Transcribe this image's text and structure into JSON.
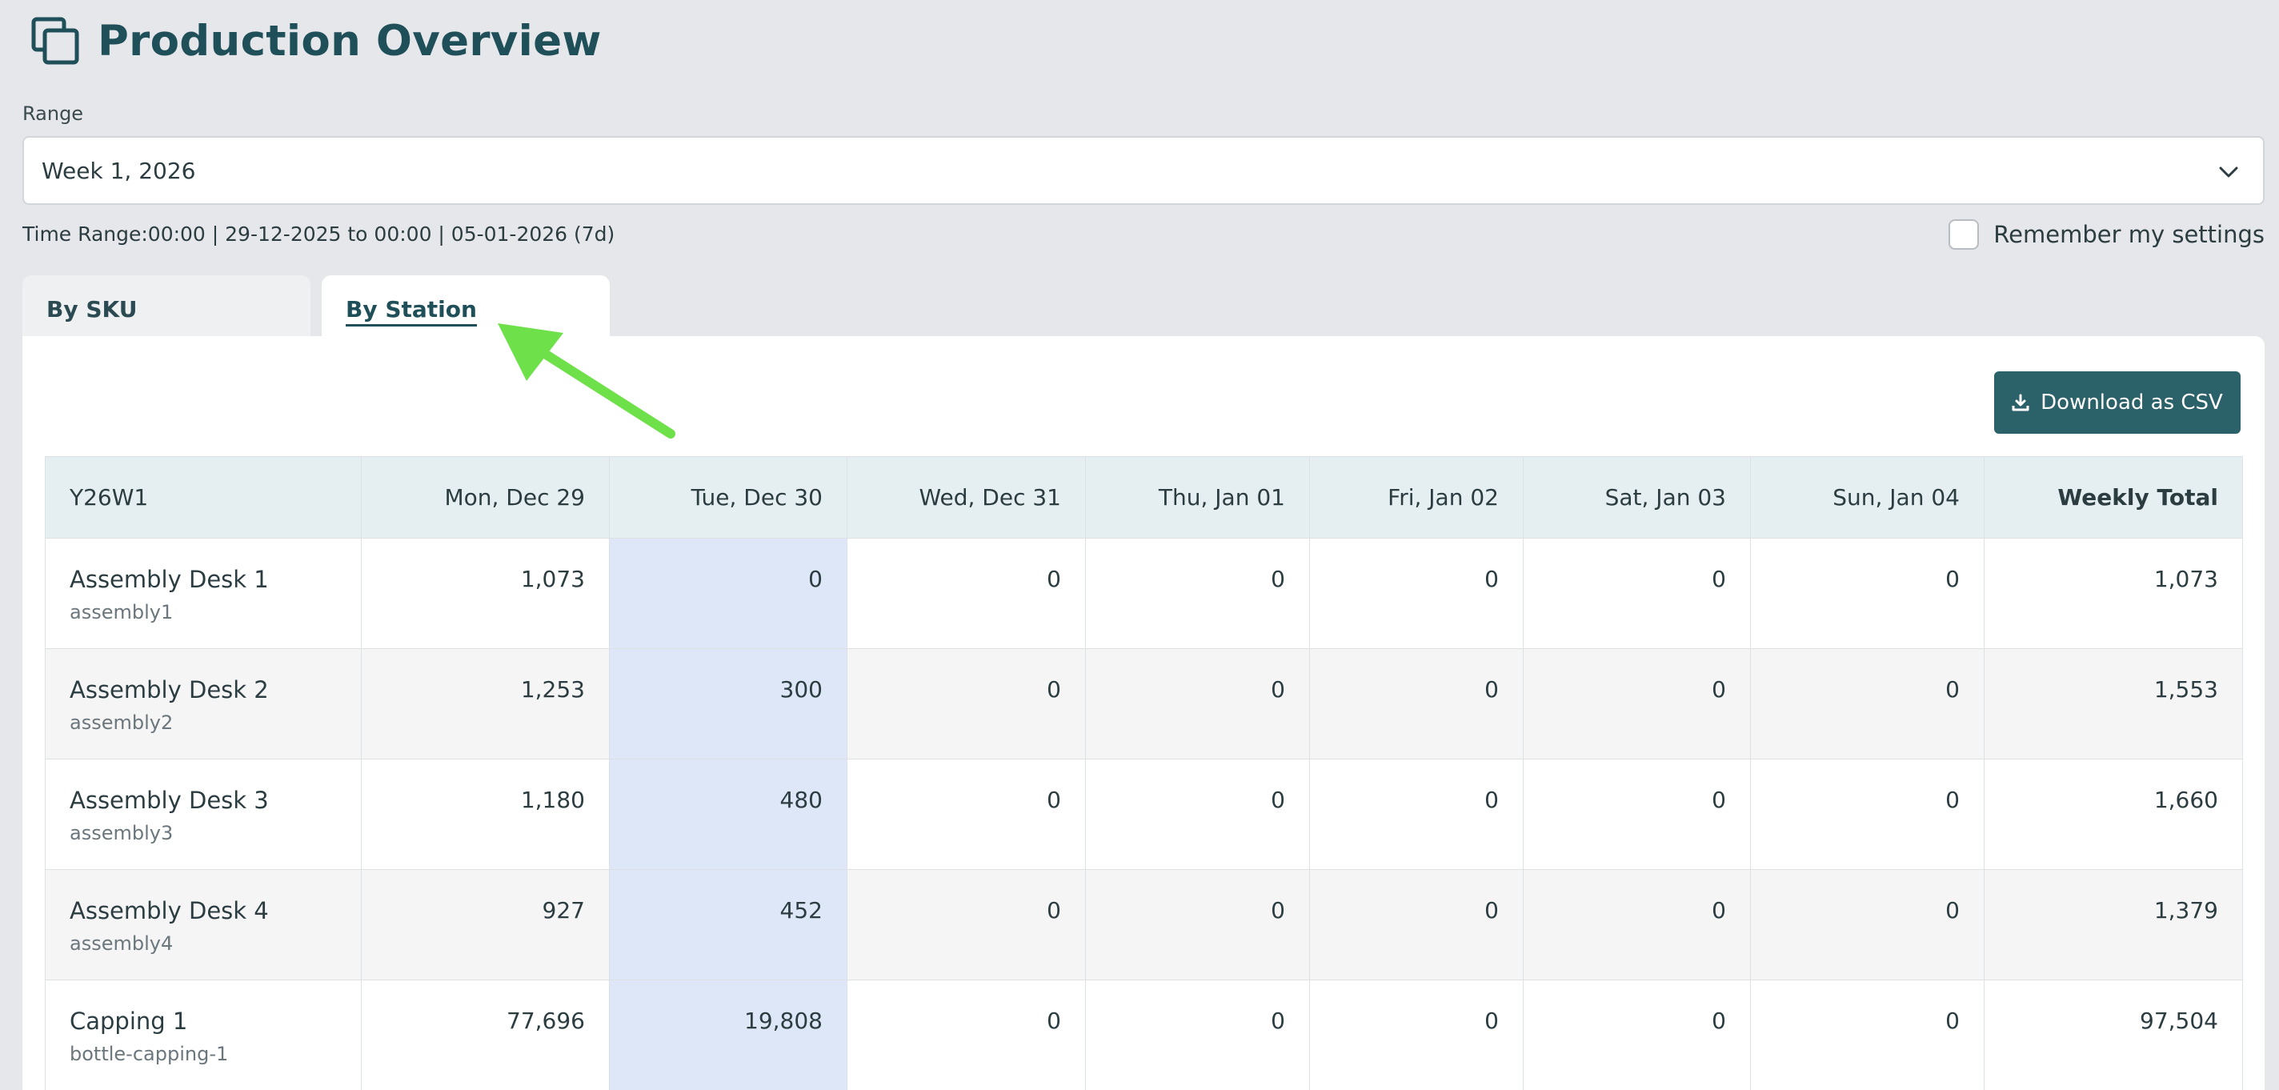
{
  "header": {
    "title": "Production Overview",
    "icon": "copy-icon"
  },
  "range": {
    "label": "Range",
    "selected": "Week 1, 2026"
  },
  "time_range": "Time Range:00:00 | 29-12-2025 to 00:00 | 05-01-2026 (7d)",
  "remember_label": "Remember my settings",
  "tabs": [
    {
      "label": "By SKU",
      "active": false
    },
    {
      "label": "By Station",
      "active": true
    }
  ],
  "download_label": "Download as CSV",
  "table": {
    "headers": [
      "Y26W1",
      "Mon, Dec 29",
      "Tue, Dec 30",
      "Wed, Dec 31",
      "Thu, Jan 01",
      "Fri, Jan 02",
      "Sat, Jan 03",
      "Sun, Jan 04",
      "Weekly Total"
    ],
    "rows": [
      {
        "name": "Assembly Desk 1",
        "code": "assembly1",
        "values": [
          "1,073",
          "0",
          "0",
          "0",
          "0",
          "0",
          "0",
          "1,073"
        ]
      },
      {
        "name": "Assembly Desk 2",
        "code": "assembly2",
        "values": [
          "1,253",
          "300",
          "0",
          "0",
          "0",
          "0",
          "0",
          "1,553"
        ]
      },
      {
        "name": "Assembly Desk 3",
        "code": "assembly3",
        "values": [
          "1,180",
          "480",
          "0",
          "0",
          "0",
          "0",
          "0",
          "1,660"
        ]
      },
      {
        "name": "Assembly Desk 4",
        "code": "assembly4",
        "values": [
          "927",
          "452",
          "0",
          "0",
          "0",
          "0",
          "0",
          "1,379"
        ]
      },
      {
        "name": "Capping 1",
        "code": "bottle-capping-1",
        "values": [
          "77,696",
          "19,808",
          "0",
          "0",
          "0",
          "0",
          "0",
          "97,504"
        ]
      }
    ]
  },
  "colors": {
    "brand": "#1f4f59",
    "button": "#2b6169",
    "highlight_column": "#dde7f7",
    "annotation_arrow": "#6ee04a"
  }
}
